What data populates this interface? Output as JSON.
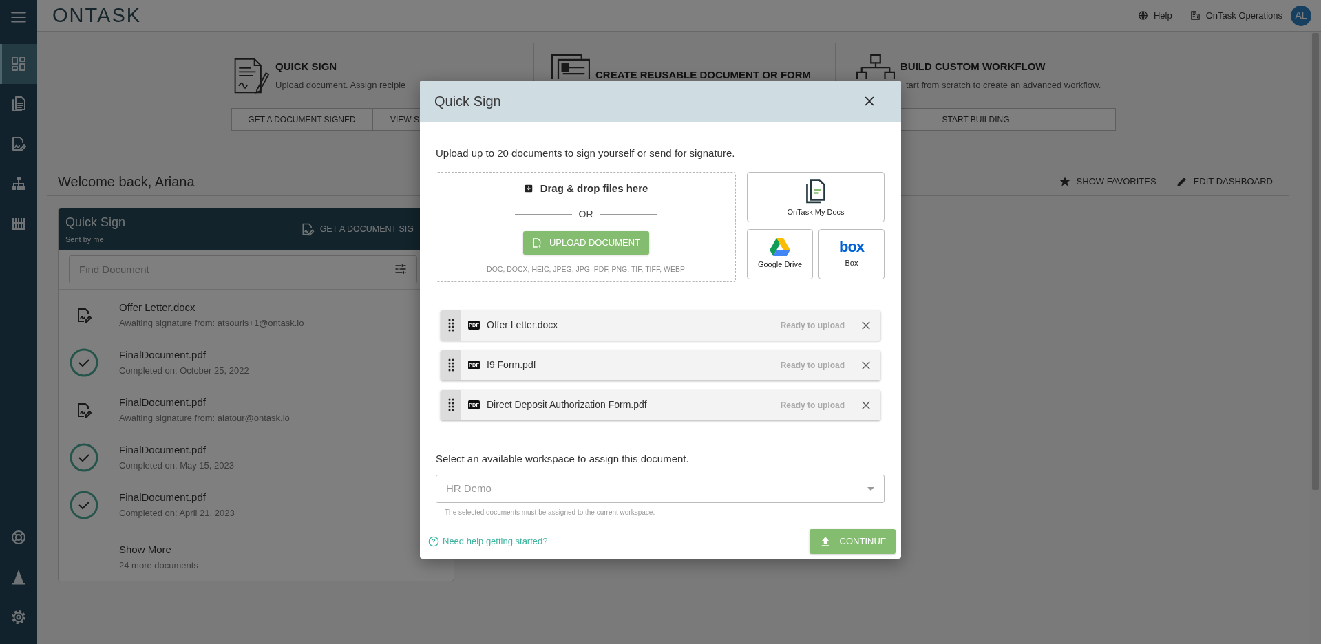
{
  "sidebar": {
    "items": [
      {
        "kind": "dashboard",
        "selected": true
      },
      {
        "kind": "documents",
        "selected": false
      },
      {
        "kind": "signature",
        "selected": false
      },
      {
        "kind": "hierarchy",
        "selected": false
      },
      {
        "kind": "columns",
        "selected": false
      }
    ],
    "bottom_items": [
      {
        "kind": "support",
        "selected": false
      },
      {
        "kind": "wizard",
        "selected": false
      },
      {
        "kind": "settings",
        "selected": false
      }
    ]
  },
  "header": {
    "logo": "ONTASK",
    "help": "Help",
    "organization": "OnTask Operations",
    "avatar": "AL"
  },
  "actions": [
    {
      "kind": "quick-sign",
      "title": "QUICK SIGN",
      "description": "Upload document. Assign recipie",
      "buttons": [
        "GET A DOCUMENT SIGNED",
        "VIEW S"
      ]
    },
    {
      "kind": "reusable",
      "title": "CREATE REUSABLE DOCUMENT OR FORM"
    },
    {
      "kind": "workflow",
      "title": "BUILD CUSTOM WORKFLOW",
      "description": "tart from scratch to create an advanced workflow.",
      "buttons": [
        "START BUILDING"
      ]
    }
  ],
  "welcome": "Welcome back, Ariana",
  "dashboard_actions": [
    {
      "kind": "favorites",
      "label": "SHOW FAVORITES"
    },
    {
      "kind": "edit",
      "label": "EDIT DASHBOARD"
    }
  ],
  "quick_sign_card": {
    "title": "Quick Sign",
    "subtitle": "Sent by me",
    "action": "GET A DOCUMENT SIG",
    "search": {
      "placeholder": "Find Document"
    },
    "documents": [
      {
        "kind": "awaiting",
        "name": "Offer Letter.docx",
        "detail": "Awaiting signature from: atsouris+1@ontask.io"
      },
      {
        "kind": "completed",
        "name": "FinalDocument.pdf",
        "detail": "Completed on: October 25, 2022"
      },
      {
        "kind": "awaiting",
        "name": "FinalDocument.pdf",
        "detail": "Awaiting signature from: alatour@ontask.io"
      },
      {
        "kind": "completed",
        "name": "FinalDocument.pdf",
        "detail": "Completed on: May 15, 2023"
      },
      {
        "kind": "completed",
        "name": "FinalDocument.pdf",
        "detail": "Completed on: April 21, 2023"
      }
    ],
    "show_more": {
      "label": "Show More",
      "detail": "24 more documents"
    }
  },
  "modal": {
    "title": "Quick Sign",
    "intro": "Upload up to 20 documents to sign yourself or send for signature.",
    "dropzone": {
      "heading": "Drag & drop files here",
      "or": "OR",
      "button": "UPLOAD DOCUMENT",
      "formats": "DOC, DOCX, HEIC, JPEG, JPG, PDF, PNG, TIF, TIFF, WEBP"
    },
    "sources": [
      {
        "kind": "mydocs",
        "label": "OnTask My Docs"
      },
      {
        "kind": "gdrive",
        "label": "Google Drive"
      },
      {
        "kind": "box",
        "label": "Box",
        "logo_text": "box"
      }
    ],
    "files": [
      {
        "badge": "PDF",
        "name": "Offer Letter.docx",
        "status": "Ready to upload"
      },
      {
        "badge": "PDF",
        "name": "I9 Form.pdf",
        "status": "Ready to upload"
      },
      {
        "badge": "PDF",
        "name": "Direct Deposit Authorization Form.pdf",
        "status": "Ready to upload"
      }
    ],
    "workspace": {
      "label": "Select an available workspace to assign this document.",
      "value": "HR Demo",
      "help": "The selected documents must be assigned to the current workspace."
    },
    "help_link": "Need help getting started?",
    "continue": "CONTINUE"
  }
}
